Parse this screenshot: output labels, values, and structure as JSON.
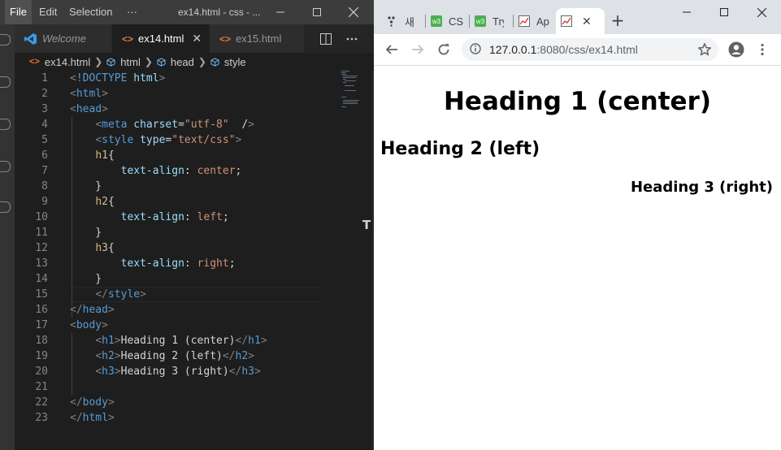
{
  "vscode": {
    "menu": [
      "File",
      "Edit",
      "Selection",
      "···"
    ],
    "window_title": "ex14.html - css - ...",
    "tabs": [
      {
        "label": "Welcome",
        "icon": "vscode-logo-icon"
      },
      {
        "label": "ex14.html",
        "icon": "html-file-icon",
        "active": true,
        "close": "✕"
      },
      {
        "label": "ex15.html",
        "icon": "html-file-icon"
      }
    ],
    "breadcrumb": [
      "ex14.html",
      "html",
      "head",
      "style"
    ],
    "line_numbers": [
      "1",
      "2",
      "3",
      "4",
      "5",
      "6",
      "7",
      "8",
      "9",
      "10",
      "11",
      "12",
      "13",
      "14",
      "15",
      "16",
      "17",
      "18",
      "19",
      "20",
      "21",
      "22",
      "23"
    ],
    "code_lines": [
      "<!DOCTYPE html>",
      "<html>",
      "<head>",
      "    <meta charset=\"utf-8\"  />",
      "    <style type=\"text/css\">",
      "    h1{",
      "        text-align: center;",
      "    }",
      "    h2{",
      "        text-align: left;",
      "    }",
      "    h3{",
      "        text-align: right;",
      "    }",
      "    </style>",
      "</head>",
      "<body>",
      "    <h1>Heading 1 (center)</h1>",
      "    <h2>Heading 2 (left)</h2>",
      "    <h3>Heading 3 (right)</h3>",
      "",
      "</body>",
      "</html>"
    ],
    "colors": {
      "tag": "#569cd6",
      "attribute": "#9cdcfe",
      "string": "#ce9178",
      "selector": "#d7ba7d",
      "background": "#1e1e1e"
    }
  },
  "chrome": {
    "tabs": [
      {
        "label": "새",
        "icon": "dots-icon"
      },
      {
        "label": "CS",
        "icon": "w3-icon"
      },
      {
        "label": "Try",
        "icon": "w3-icon"
      },
      {
        "label": "Ap",
        "icon": "image-icon"
      },
      {
        "label": "",
        "icon": "image-icon",
        "active": true,
        "close": "✕"
      }
    ],
    "new_tab": "+",
    "url_host": "127.0.0.1",
    "url_path": ":8080/css/ex14.html",
    "page": {
      "h1": "Heading 1 (center)",
      "h2": "Heading 2 (left)",
      "h3": "Heading 3 (right)"
    }
  },
  "splitter_glyph": "T"
}
